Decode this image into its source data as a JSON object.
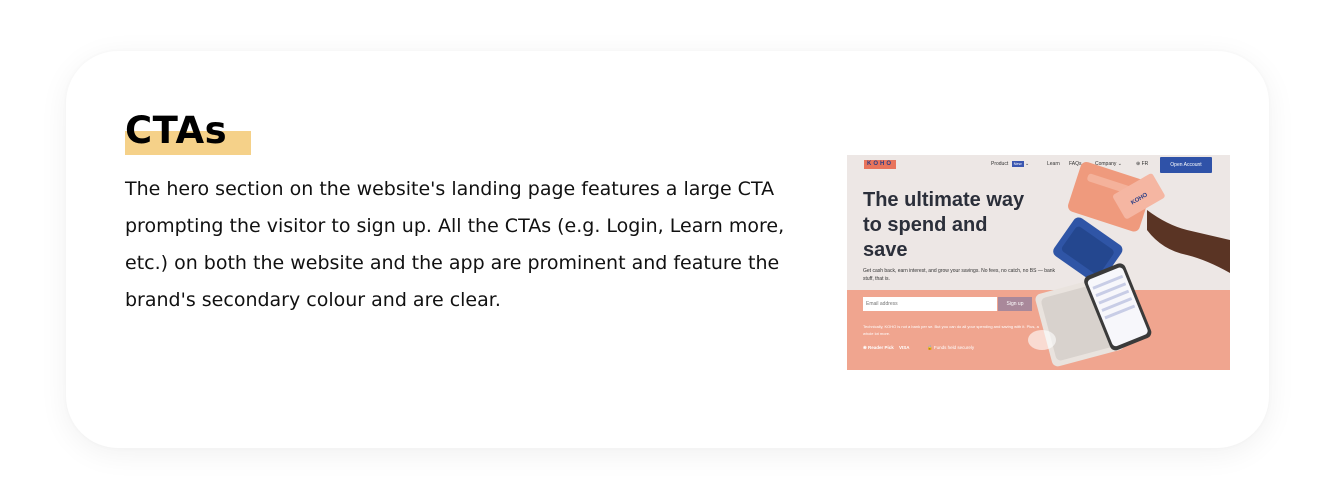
{
  "section": {
    "title": "CTAs",
    "paragraph": "The hero section on the website's landing page features a large CTA prompting the visitor to sign up. All the CTAs (e.g. Login, Learn more, etc.) on both the website and the app are prominent and feature the brand's secondary colour and are clear.",
    "highlight_color": "#f5d189"
  },
  "screenshot": {
    "logo": "KOHO",
    "nav": {
      "product": "Product",
      "new_badge": "New",
      "learn": "Learn",
      "faqs": "FAQs",
      "company": "Company",
      "lang": "FR",
      "open_account": "Open Account"
    },
    "hero_title": "The ultimate way to spend and save",
    "hero_sub": "Get cash back, earn interest, and grow your savings. No fees, no catch, no BS — bank stuff, that is.",
    "email_placeholder": "Email address",
    "signup": "Sign up",
    "fine_print": "Technically, KOHO is not a bank per se. But you can do all your spending and saving with it. Plus, a whole lot more.",
    "trust": {
      "badge": "Reader Pick",
      "visa": "VISA",
      "funds": "Funds held securely"
    },
    "colors": {
      "brand_blue": "#2f52a8",
      "salmon": "#f0a58f",
      "signup": "#a9889a"
    }
  }
}
